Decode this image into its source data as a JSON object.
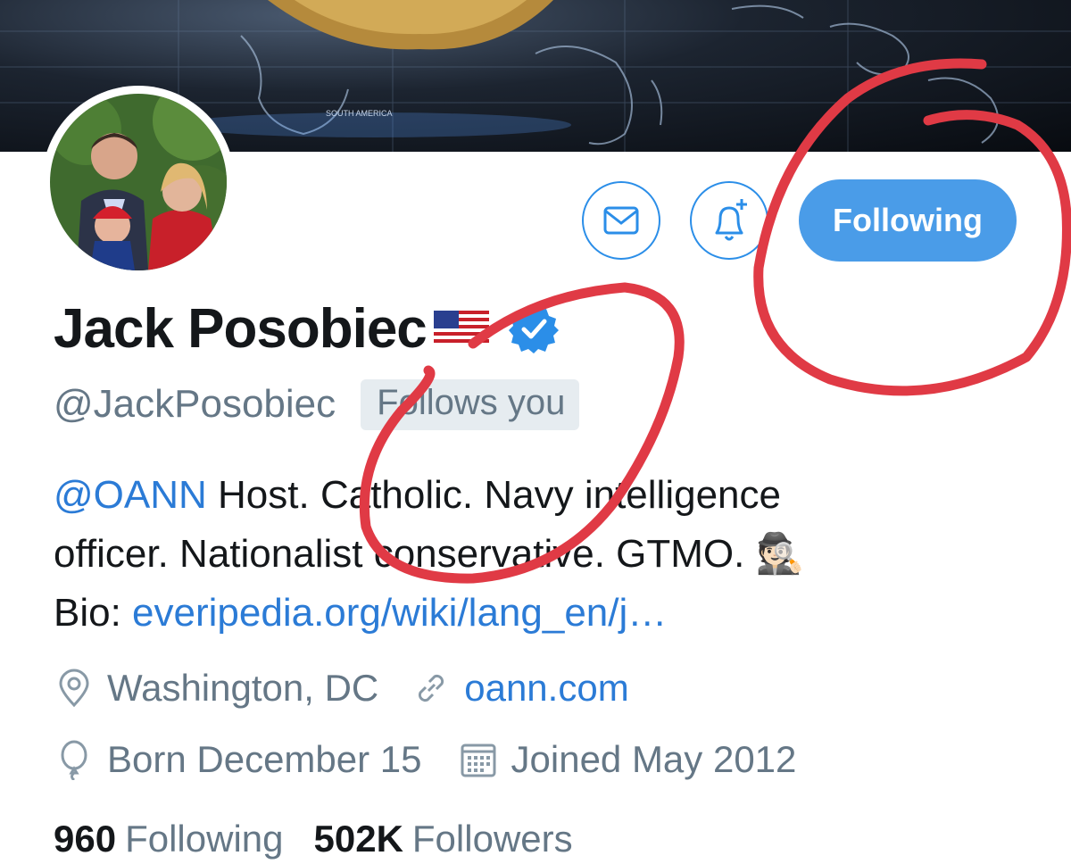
{
  "banner": {
    "map_label": "SOUTH AMERICA"
  },
  "profile": {
    "name": "Jack Posobiec",
    "handle": "@JackPosobiec",
    "follows_you": "Follows you"
  },
  "actions": {
    "message_icon": "envelope-icon",
    "notify_icon": "bell-plus-icon",
    "follow_label": "Following",
    "accent_color": "#4a9ce8"
  },
  "bio": {
    "mention": "@OANN",
    "line1_text": " Host. Catholic. Navy intelligence",
    "line2_text": "officer. Nationalist conservative. GTMO. ",
    "line2_emoji": "🕵🏻",
    "line3_prefix": "Bio: ",
    "line3_link": "everipedia.org/wiki/lang_en/j…"
  },
  "meta": {
    "location": "Washington, DC",
    "website": "oann.com",
    "birthday": "Born December 15",
    "joined": "Joined May 2012"
  },
  "stats": {
    "following_count": "960",
    "following_label": "Following",
    "followers_count": "502K",
    "followers_label": "Followers"
  },
  "annotation": {
    "color": "#e03a45"
  }
}
